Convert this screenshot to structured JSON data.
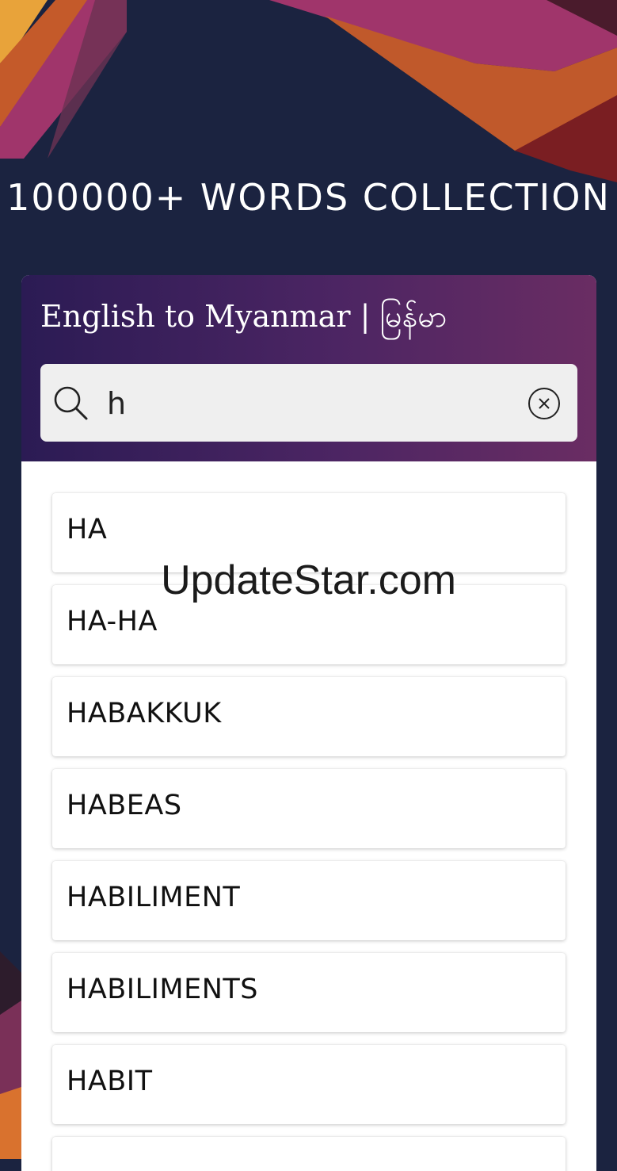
{
  "headline": "100000+ WORDS COLLECTION",
  "app": {
    "title": "English to Myanmar | မြန်မာ"
  },
  "search": {
    "value": "h",
    "search_icon": "search-icon",
    "clear_icon": "clear-circle-icon"
  },
  "results": [
    {
      "label": "HA"
    },
    {
      "label": "HA-HA"
    },
    {
      "label": "HABAKKUK"
    },
    {
      "label": "HABEAS"
    },
    {
      "label": "HABILIMENT"
    },
    {
      "label": "HABILIMENTS"
    },
    {
      "label": "HABIT"
    },
    {
      "label": ""
    }
  ],
  "watermark": "UpdateStar.com",
  "colors": {
    "background": "#1b2340",
    "header_start": "#2b1b54",
    "header_end": "#6a2d63",
    "shape_orange": "#e0712e",
    "shape_magenta": "#a0356b"
  }
}
